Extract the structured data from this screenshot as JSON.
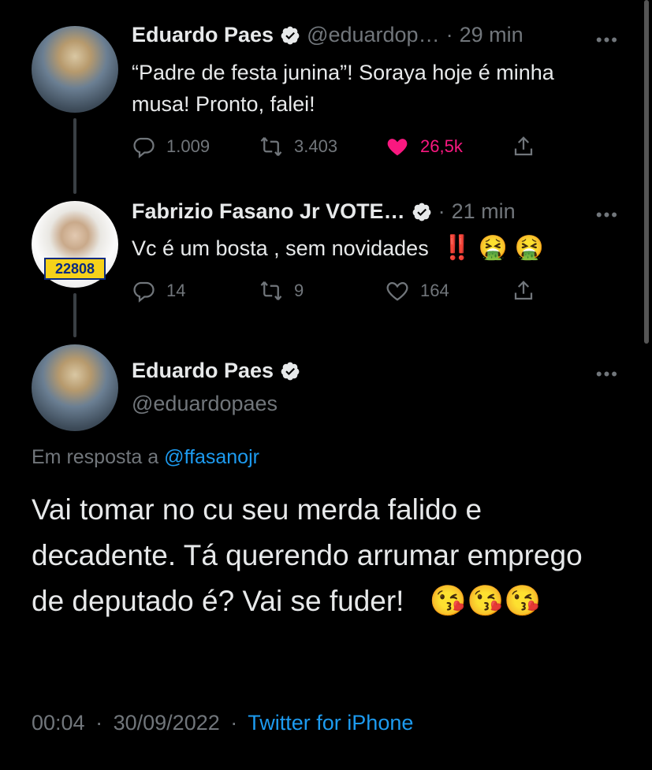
{
  "tweets": [
    {
      "name": "Eduardo Paes",
      "handle": "@eduardop…",
      "dot": "·",
      "time": "29 min",
      "text": "“Padre de festa junina”!  Soraya hoje é minha musa!  Pronto, falei!",
      "replies": "1.009",
      "retweets": "3.403",
      "likes": "26,5k",
      "liked": true
    },
    {
      "name": "Fabrizio Fasano Jr VOTE…",
      "dot": "·",
      "time": "21 min",
      "text": "Vc é um bosta , sem novidades",
      "emojis": "‼️ 🤮 🤮",
      "replies": "14",
      "retweets": "9",
      "likes": "164",
      "avatar_badge": "22808",
      "liked": false
    }
  ],
  "main": {
    "name": "Eduardo Paes",
    "handle": "@eduardopaes",
    "reply_prefix": "Em resposta a",
    "reply_handle": "@ffasanojr",
    "text": "Vai tomar no cu seu merda falido e decadente.  Tá querendo arrumar emprego de deputado é?  Vai se fuder!",
    "emojis": "😘😘😘",
    "time": "00:04",
    "dot": "·",
    "date": "30/09/2022",
    "source": "Twitter for iPhone"
  },
  "more_label": "•••",
  "colors": {
    "background": "#000000",
    "text": "#e7e9ea",
    "muted": "#71767b",
    "link": "#1d9bf0",
    "like": "#f91880",
    "verified": "#e7e9ea"
  },
  "icons": [
    "verified-icon",
    "reply-icon",
    "retweet-icon",
    "like-icon",
    "share-icon",
    "more-icon"
  ]
}
